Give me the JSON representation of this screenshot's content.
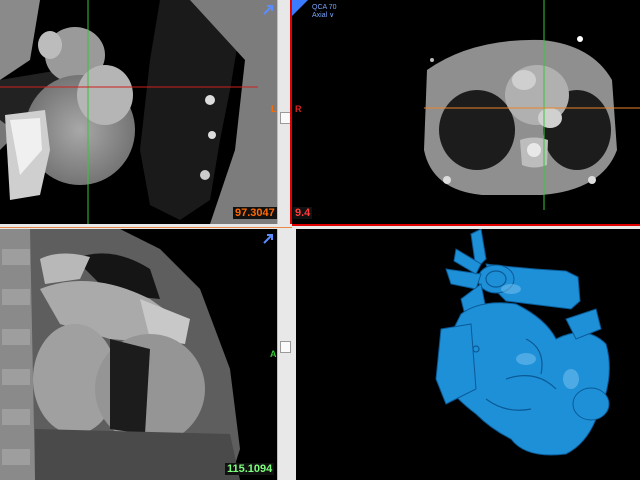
{
  "viewports": {
    "top_left": {
      "readout": "97.3047",
      "orientation_left": "L",
      "expand_icon": "expand-arrow-icon"
    },
    "top_right": {
      "readout": "9.4",
      "orientation_right": "R",
      "tag_line1": "QCA 70",
      "tag_line2": "Axial ∨"
    },
    "bottom_left": {
      "readout": "115.1094",
      "orientation_label": "A",
      "expand_icon": "expand-arrow-icon"
    },
    "bottom_right": {
      "render": "3d-vessel-render"
    }
  },
  "colors": {
    "readout_orange": "#ff6a00",
    "readout_red": "#ff3b3b",
    "readout_green": "#7dff7d",
    "separator_red": "#e00000",
    "crosshair_green": "#37c837",
    "crosshair_red": "#d02020",
    "crosshair_orange": "#e8862a",
    "render_blue": "#1e90d8"
  }
}
